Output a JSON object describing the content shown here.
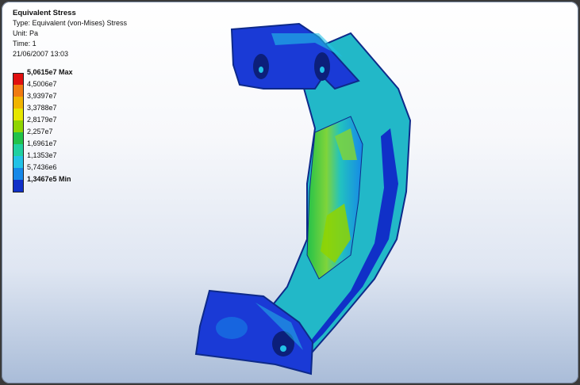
{
  "result": {
    "title": "Equivalent Stress",
    "type_line": "Type: Equivalent (von-Mises) Stress",
    "unit_line": "Unit: Pa",
    "time_line": "Time: 1",
    "timestamp": "21/06/2007 13:03"
  },
  "legend": {
    "labels": [
      "5,0615e7 Max",
      "4,5006e7",
      "3,9397e7",
      "3,3788e7",
      "2,8179e7",
      "2,257e7",
      "1,6961e7",
      "1,1353e7",
      "5,7436e6",
      "1,3467e5 Min"
    ],
    "colors": [
      "#e01010",
      "#f07a10",
      "#f0b400",
      "#e6e600",
      "#8fd400",
      "#22c24a",
      "#20d0a0",
      "#22c2e6",
      "#1688e8",
      "#1030c8"
    ]
  },
  "model": {
    "description_icon": "bracket-stress-contour",
    "colors": {
      "low": "#1030c8",
      "mid": "#22c2e6",
      "high": "#8fd400"
    }
  }
}
